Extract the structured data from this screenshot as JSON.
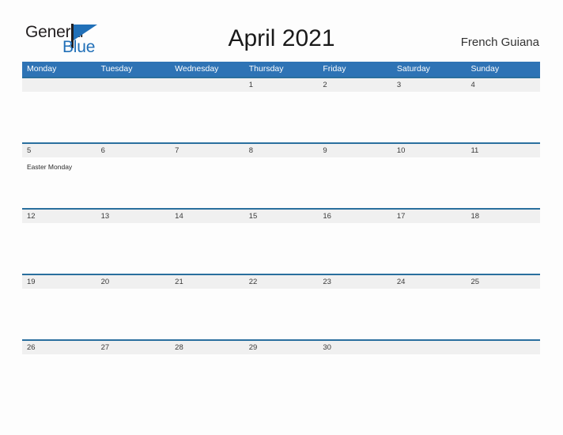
{
  "brand": {
    "name_part1": "General",
    "name_part2": "Blue",
    "flag_color": "#2170b8",
    "pole_color": "#231f20"
  },
  "header": {
    "title": "April 2021",
    "location": "French Guiana"
  },
  "calendar": {
    "header_bg": "#2e73b5",
    "date_band_bg": "#f0f0f0",
    "rule_color": "#2a6f9e",
    "weekdays": [
      "Monday",
      "Tuesday",
      "Wednesday",
      "Thursday",
      "Friday",
      "Saturday",
      "Sunday"
    ],
    "weeks": [
      {
        "dates": [
          "",
          "",
          "",
          "1",
          "2",
          "3",
          "4"
        ],
        "events": [
          "",
          "",
          "",
          "",
          "",
          "",
          ""
        ]
      },
      {
        "dates": [
          "5",
          "6",
          "7",
          "8",
          "9",
          "10",
          "11"
        ],
        "events": [
          "Easter Monday",
          "",
          "",
          "",
          "",
          "",
          ""
        ]
      },
      {
        "dates": [
          "12",
          "13",
          "14",
          "15",
          "16",
          "17",
          "18"
        ],
        "events": [
          "",
          "",
          "",
          "",
          "",
          "",
          ""
        ]
      },
      {
        "dates": [
          "19",
          "20",
          "21",
          "22",
          "23",
          "24",
          "25"
        ],
        "events": [
          "",
          "",
          "",
          "",
          "",
          "",
          ""
        ]
      },
      {
        "dates": [
          "26",
          "27",
          "28",
          "29",
          "30",
          "",
          ""
        ],
        "events": [
          "",
          "",
          "",
          "",
          "",
          "",
          ""
        ]
      }
    ]
  }
}
